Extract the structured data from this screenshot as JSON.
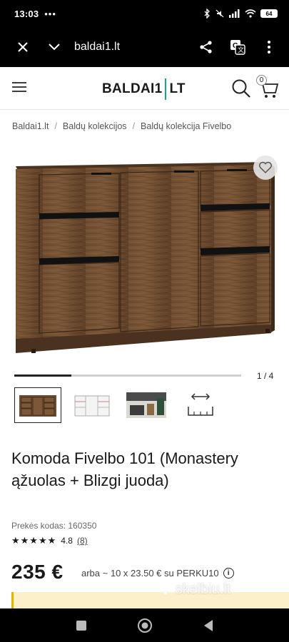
{
  "status": {
    "time": "13:03",
    "dots": "•••",
    "battery": "64"
  },
  "browser": {
    "url": "baldai1.lt",
    "icons": [
      "close-icon",
      "chevron-down-icon",
      "share-icon",
      "translate-icon",
      "more-vertical-icon"
    ]
  },
  "header": {
    "logo_left": "BALDAI1",
    "logo_right": "LT",
    "cart_count": "0",
    "accent": "#1aa48c"
  },
  "breadcrumb": [
    "Baldai1.lt",
    "Baldų kolekcijos",
    "Baldų kolekcija Fivelbo"
  ],
  "breadcrumb_sep": "/",
  "gallery": {
    "counter": "1 / 4",
    "progress": 0.25
  },
  "product": {
    "title": "Komoda Fivelbo 101 (Monastery ąžuolas + Blizgi juoda)",
    "sku": "Prekės kodas: 160350",
    "stars": "★★★★★",
    "rating": "4.8",
    "review_count": "(8)",
    "price": "235 €",
    "credit_text": "arba ~ 10 x 23.50 € su PERKU10",
    "info": "i"
  },
  "watermark": "skelbiu.lt"
}
